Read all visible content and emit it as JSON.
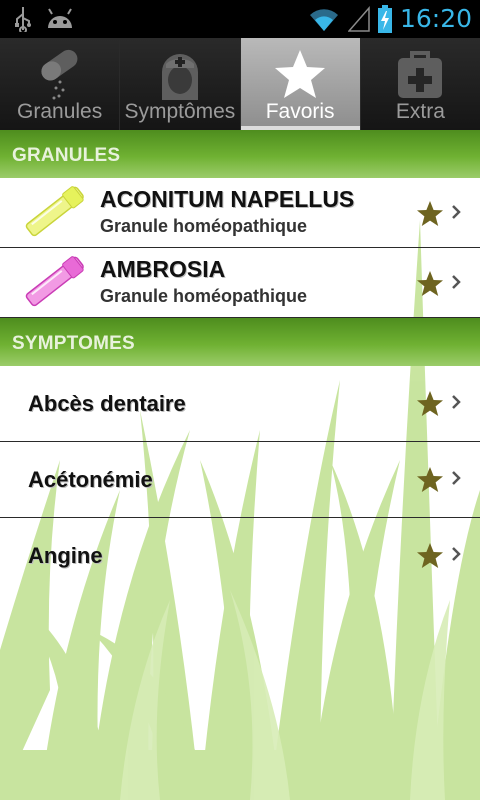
{
  "status_bar": {
    "left_icons": [
      "usb-icon",
      "android-icon"
    ],
    "right_icons": [
      "wifi-icon",
      "signal-icon",
      "battery-charging-icon"
    ],
    "time": "16:20",
    "time_color": "#39b7e8"
  },
  "tabs": [
    {
      "label": "Granules",
      "icon": "granules-icon",
      "active": false
    },
    {
      "label": "Symptômes",
      "icon": "nurse-icon",
      "active": false
    },
    {
      "label": "Favoris",
      "icon": "star-icon",
      "active": true
    },
    {
      "label": "Extra",
      "icon": "first-aid-kit-icon",
      "active": false
    }
  ],
  "sections": {
    "granules": {
      "header": "GRANULES",
      "items": [
        {
          "title": "ACONITUM NAPELLUS",
          "subtitle": "Granule homéopathique",
          "tube_color": "#e6f25c"
        },
        {
          "title": "AMBROSIA",
          "subtitle": "Granule homéopathique",
          "tube_color": "#e86ad6"
        }
      ]
    },
    "symptomes": {
      "header": "SYMPTOMES",
      "items": [
        {
          "title": "Abcès dentaire"
        },
        {
          "title": "Acétonémie"
        },
        {
          "title": "Angine"
        }
      ]
    }
  },
  "colors": {
    "accent_green": "#6fb132",
    "favorite_star": "#6e6420",
    "grass": "#b7dc82"
  }
}
